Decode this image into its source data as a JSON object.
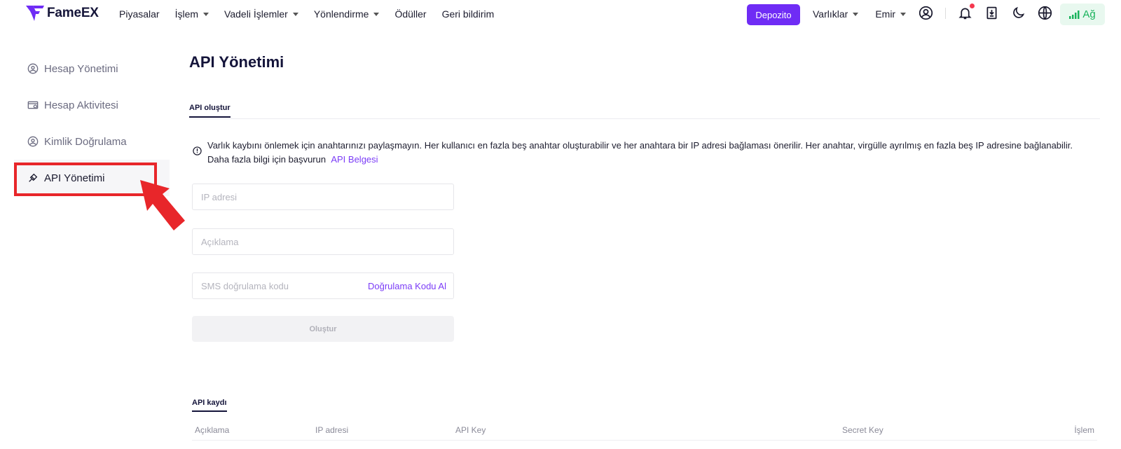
{
  "brand": {
    "name": "FameEX"
  },
  "nav": {
    "items": [
      {
        "label": "Piyasalar",
        "dropdown": false
      },
      {
        "label": "İşlem",
        "dropdown": true
      },
      {
        "label": "Vadeli İşlemler",
        "dropdown": true
      },
      {
        "label": "Yönlendirme",
        "dropdown": true
      },
      {
        "label": "Ödüller",
        "dropdown": false
      },
      {
        "label": "Geri bildirim",
        "dropdown": false
      }
    ],
    "deposit_label": "Depozito",
    "assets_label": "Varlıklar",
    "orders_label": "Emir",
    "network_label": "Ağ",
    "icons": [
      "user-icon",
      "bell-icon",
      "download-icon",
      "moon-icon",
      "globe-icon"
    ]
  },
  "sidebar": {
    "items": [
      {
        "label": "Hesap Yönetimi",
        "icon": "user-circle-icon",
        "active": false
      },
      {
        "label": "Hesap Aktivitesi",
        "icon": "activity-icon",
        "active": false
      },
      {
        "label": "Kimlik Doğrulama",
        "icon": "id-icon",
        "active": false
      },
      {
        "label": "API Yönetimi",
        "icon": "link-icon",
        "active": true
      }
    ]
  },
  "main": {
    "title": "API Yönetimi",
    "tab_label": "API oluştur",
    "notice_text": "Varlık kaybını önlemek için anahtarınızı paylaşmayın. Her kullanıcı en fazla beş anahtar oluşturabilir ve her anahtara bir IP adresi bağlaması önerilir. Her anahtar, virgülle ayrılmış en fazla beş IP adresine bağlanabilir. Daha fazla bilgi için başvurun",
    "notice_link": "API Belgesi",
    "form": {
      "ip_placeholder": "IP adresi",
      "desc_placeholder": "Açıklama",
      "sms_placeholder": "SMS doğrulama kodu",
      "get_code_label": "Doğrulama Kodu Al",
      "create_label": "Oluştur"
    },
    "log": {
      "tab_label": "API kaydı",
      "columns": [
        "Açıklama",
        "IP adresi",
        "API Key",
        "Secret Key",
        "İşlem"
      ]
    }
  },
  "colors": {
    "accent": "#6f2cf5",
    "link": "#7b3cf7",
    "highlight": "#e8262a",
    "network_green": "#19b35c"
  }
}
